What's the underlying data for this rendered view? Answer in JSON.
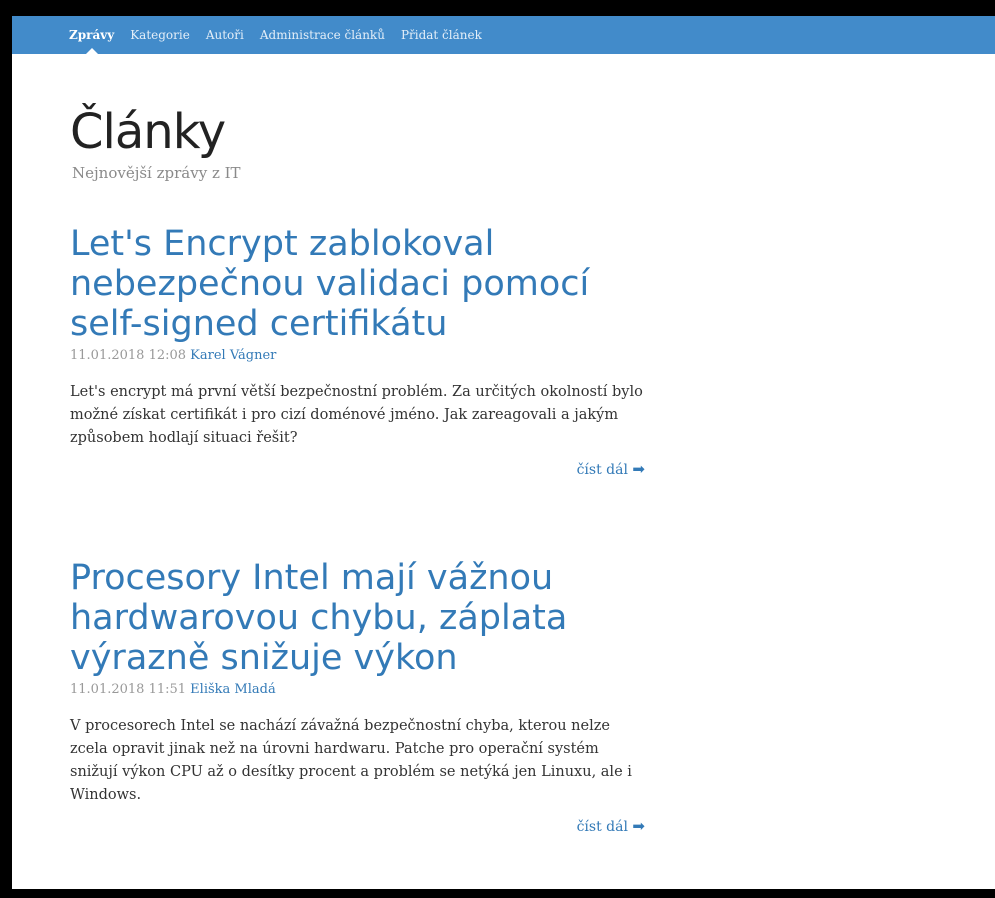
{
  "nav": {
    "items": [
      {
        "label": "Zprávy",
        "active": true
      },
      {
        "label": "Kategorie",
        "active": false
      },
      {
        "label": "Autoři",
        "active": false
      },
      {
        "label": "Administrace článků",
        "active": false
      },
      {
        "label": "Přidat článek",
        "active": false
      }
    ]
  },
  "page": {
    "title": "Články",
    "subtitle": "Nejnovější zprávy z IT"
  },
  "articles": [
    {
      "title": "Let's Encrypt zablokoval nebezpečnou validaci pomocí self-signed certifikátu",
      "date": "11.01.2018 12:08",
      "author": "Karel Vágner",
      "perex": "Let's encrypt má první větší bezpečnostní problém. Za určitých okolností bylo možné získat certifikát i pro cizí doménové jméno. Jak zareagovali a jakým způsobem hodlají situaci řešit?",
      "read_more": "číst dál"
    },
    {
      "title": "Procesory Intel mají vážnou hardwarovou chybu, záplata výrazně snižuje výkon",
      "date": "11.01.2018 11:51",
      "author": "Eliška Mladá",
      "perex": "V procesorech Intel se nachází závažná bezpečnostní chyba, kterou nelze zcela opravit jinak než na úrovni hardwaru. Patche pro operační systém snižují výkon CPU až o desítky procent a problém se netýká jen Linuxu, ale i Windows.",
      "read_more": "číst dál"
    }
  ],
  "colors": {
    "navbar": "#428bca",
    "link": "#337ab7"
  },
  "icons": {
    "read_more": "arrow-right-icon"
  }
}
